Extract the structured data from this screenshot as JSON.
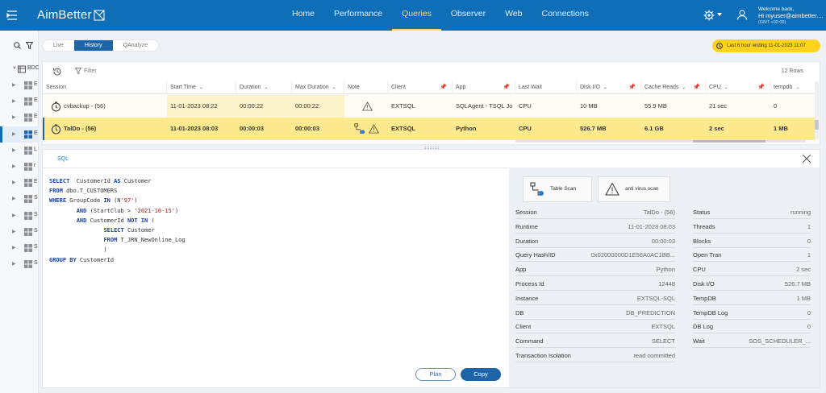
{
  "app": {
    "logo": "AimBetter"
  },
  "nav": [
    "Home",
    "Performance",
    "Queries",
    "Observer",
    "Web",
    "Connections"
  ],
  "nav_active": 2,
  "user": {
    "welcome": "Welcome back,",
    "name": "Hi myuser@aimbetter....",
    "tz": "(GMT +02:00)"
  },
  "sidebar": {
    "root_label": "BDC",
    "items": [
      "E",
      "E",
      "E",
      "E",
      "L",
      "r",
      "E",
      "S",
      "S",
      "S",
      "S",
      "S"
    ],
    "selected": 3
  },
  "tabs": [
    "Live",
    "History",
    "QAnalyze"
  ],
  "tab_active": 1,
  "time_badge": "Last 6 hour ending 11-01-2023 11:07",
  "toolbar": {
    "filter": "Filter",
    "row_count": "12 Rows"
  },
  "columns": [
    "Session",
    "Start Time",
    "Duration",
    "Max Duration",
    "Note",
    "Client",
    "App",
    "Last Wait",
    "Disk I/O",
    "Cache Reads",
    "CPU",
    "tempdb"
  ],
  "rows": [
    {
      "session": "cvbackup - (56)",
      "start": "11-01-2023 08:22",
      "duration": "00:00:22",
      "max_duration": "00:00:22",
      "client": "EXTSQL",
      "app": "SQLAgent - TSQL Jo",
      "last_wait": "CPU",
      "disk": "10 MB",
      "cache": "55.9 MB",
      "cpu": "21 sec",
      "tempdb": "0"
    },
    {
      "session": "TalDo - (56)",
      "start": "11-01-2023 08:03",
      "duration": "00:00:03",
      "max_duration": "00:00:03",
      "client": "EXTSQL",
      "app": "Python",
      "last_wait": "CPU",
      "disk": "526.7 MB",
      "cache": "6.1 GB",
      "cpu": "2 sec",
      "tempdb": "1 MB"
    }
  ],
  "detail_tab": "SQL",
  "sql_lines": [
    [
      [
        "kw",
        "SELECT"
      ],
      [
        "",
        "  CustomerId "
      ],
      [
        "kw",
        "AS"
      ],
      [
        "",
        " Customer"
      ]
    ],
    [
      [
        "kw",
        "FROM"
      ],
      [
        "",
        " dbo.T_CUSTOMERS"
      ]
    ],
    [
      [
        "kw",
        "WHERE"
      ],
      [
        "",
        " GroupCode "
      ],
      [
        "kw",
        "IN"
      ],
      [
        "",
        " (N"
      ],
      [
        "str",
        "'97'"
      ],
      [
        "",
        ")"
      ]
    ],
    [
      [
        "",
        "        "
      ],
      [
        "kw",
        "AND"
      ],
      [
        "",
        " (StartClub > "
      ],
      [
        "str",
        "'2021-10-15'"
      ],
      [
        "",
        ")"
      ]
    ],
    [
      [
        "",
        "        "
      ],
      [
        "kw",
        "AND"
      ],
      [
        "",
        " CustomerId "
      ],
      [
        "kw",
        "NOT IN"
      ],
      [
        "",
        " ("
      ]
    ],
    [
      [
        "",
        "                "
      ],
      [
        "kw",
        "SELECT"
      ],
      [
        "",
        " Customer"
      ]
    ],
    [
      [
        "",
        "                "
      ],
      [
        "kw",
        "FROM"
      ],
      [
        "",
        " T_JRN_NewOnline_Log"
      ]
    ],
    [
      [
        "",
        "                )"
      ]
    ],
    [
      [
        "kw",
        "GROUP BY"
      ],
      [
        "",
        " CustomerId"
      ]
    ]
  ],
  "buttons": {
    "plan": "Plan",
    "copy": "Copy"
  },
  "warnings": [
    "Table Scan",
    "anti virus scan"
  ],
  "details_left": [
    [
      "Session",
      "TalDo - (56)"
    ],
    [
      "Runtime",
      "11-01-2023 08:03"
    ],
    [
      "Duration",
      "00:00:03"
    ],
    [
      "Query Hash/ID",
      "0x02000000D1E56A0AC1BB..."
    ],
    [
      "App",
      "Python"
    ],
    [
      "Process Id",
      "12448"
    ],
    [
      "Instance",
      "EXTSQL-SQL"
    ],
    [
      "DB",
      "DB_PREDICTION"
    ],
    [
      "Client",
      "EXTSQL"
    ],
    [
      "Command",
      "SELECT"
    ],
    [
      "Transaction Isolation",
      "read committed"
    ]
  ],
  "details_right": [
    [
      "Status",
      "running"
    ],
    [
      "Threads",
      "1"
    ],
    [
      "Blocks",
      "0"
    ],
    [
      "Open Tran",
      "1"
    ],
    [
      "CPU",
      "2 sec"
    ],
    [
      "Disk I/O",
      "526.7 MB"
    ],
    [
      "TempDB",
      "1 MB"
    ],
    [
      "TempDB Log",
      "0"
    ],
    [
      "DB Log",
      "0"
    ],
    [
      "Wait",
      "SOS_SCHEDULER_..."
    ]
  ]
}
